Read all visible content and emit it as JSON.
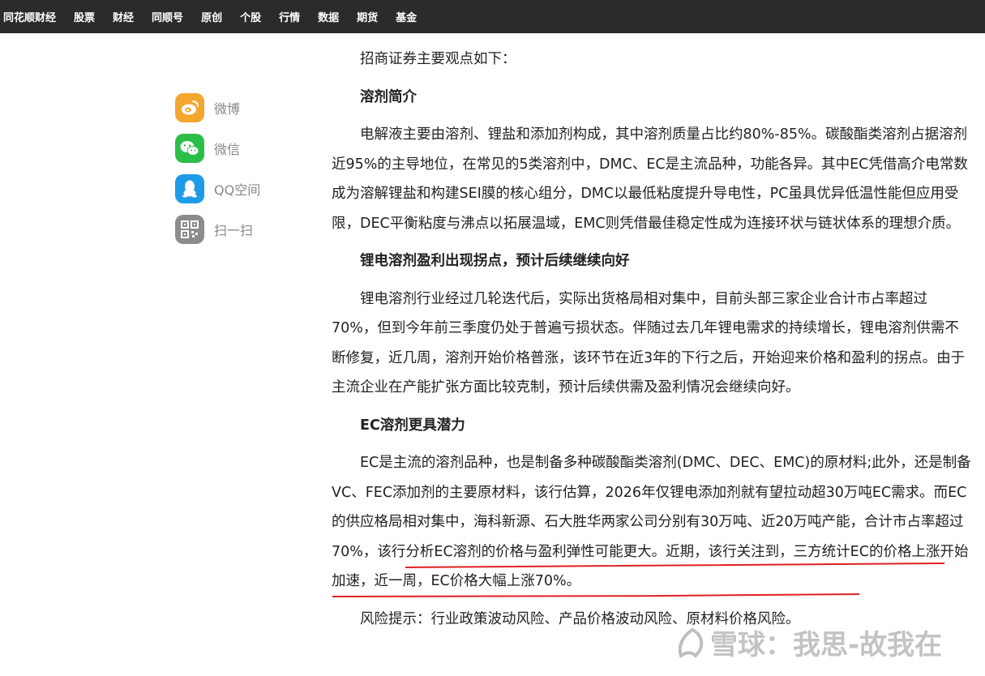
{
  "nav": {
    "items": [
      "同花顺财经",
      "股票",
      "财经",
      "同顺号",
      "原创",
      "个股",
      "行情",
      "数据",
      "期货",
      "基金"
    ]
  },
  "share": {
    "items": [
      {
        "label": "微博",
        "icon": "weibo-icon",
        "color": "#f5a62f"
      },
      {
        "label": "微信",
        "icon": "wechat-icon",
        "color": "#2bbf4a"
      },
      {
        "label": "QQ空间",
        "icon": "qq-icon",
        "color": "#1e9be8"
      },
      {
        "label": "扫一扫",
        "icon": "qrcode-icon",
        "color": "#8c8c8c"
      }
    ]
  },
  "article": {
    "intro": "招商证券主要观点如下：",
    "h1": "溶剂简介",
    "p1": "电解液主要由溶剂、锂盐和添加剂构成，其中溶剂质量占比约80%-85%。碳酸酯类溶剂占据溶剂近95%的主导地位，在常见的5类溶剂中，DMC、EC是主流品种，功能各异。其中EC凭借高介电常数成为溶解锂盐和构建SEI膜的核心组分，DMC以最低粘度提升导电性，PC虽具优异低温性能但应用受限，DEC平衡粘度与沸点以拓展温域，EMC则凭借最佳稳定性成为连接环状与链状体系的理想介质。",
    "h2": "锂电溶剂盈利出现拐点，预计后续继续向好",
    "p2": "锂电溶剂行业经过几轮迭代后，实际出货格局相对集中，目前头部三家企业合计市占率超过70%，但到今年前三季度仍处于普遍亏损状态。伴随过去几年锂电需求的持续增长，锂电溶剂供需不断修复，近几周，溶剂开始价格普涨，该环节在近3年的下行之后，开始迎来价格和盈利的拐点。由于主流企业在产能扩张方面比较克制，预计后续供需及盈利情况会继续向好。",
    "h3": "EC溶剂更具潜力",
    "p3a": "EC是主流的溶剂品种，也是制备多种碳酸酯类溶剂(DMC、DEC、EMC)的原材料;此外，还是制备VC、FEC添加剂的主要原材料，该行估算，2026年仅锂电添加剂就有望拉动超30万吨EC需求。",
    "p3b": "而EC的供应格局相对集中，海科新源、石大胜华两家公司分别有30万吨、近20万吨产能，合计市占率超过70%，该行分析EC溶剂的价格与盈利弹性可能更大。",
    "p3c": "近期，该行关注到，三方统计EC的价格上涨开始加速，近一周，EC价格大幅上涨70%。",
    "p4": "风险提示：行业政策波动风险、产品价格波动风险、原材料价格风险。"
  },
  "watermark": {
    "text": "雪球：我思-故我在",
    "icon": "snowball-logo-icon"
  },
  "colors": {
    "nav_bg": "#2b2b2b",
    "underline": "#e02020"
  }
}
